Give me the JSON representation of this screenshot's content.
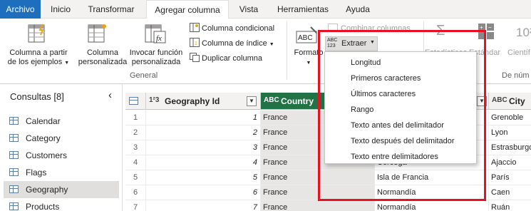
{
  "tabs": [
    "Archivo",
    "Inicio",
    "Transformar",
    "Agregar columna",
    "Vista",
    "Herramientas",
    "Ayuda"
  ],
  "ribbon": {
    "col_examples": [
      "Columna a partir",
      "de los ejemplos"
    ],
    "custom_col": [
      "Columna",
      "personalizada"
    ],
    "invoke_fn": [
      "Invocar función",
      "personalizada"
    ],
    "cond_col": "Columna condicional",
    "index_col": "Columna de índice",
    "dup_col": "Duplicar columna",
    "group_general": "General",
    "format": "Formato",
    "merge_cols": "Combinar columnas",
    "extract": "Extraer",
    "stats": "Estadísticas",
    "standard": "Estándar",
    "scientific": "Científ",
    "group_numbers": "De núm"
  },
  "extract_menu": [
    "Longitud",
    "Primeros caracteres",
    "Últimos caracteres",
    "Rango",
    "Texto antes del delimitador",
    "Texto después del delimitador",
    "Texto entre delimitadores"
  ],
  "queries": {
    "title": "Consultas [8]",
    "items": [
      "Calendar",
      "Category",
      "Customers",
      "Flags",
      "Geography",
      "Products"
    ],
    "selected": "Geography"
  },
  "grid": {
    "columns": [
      {
        "type": "1²3",
        "name": "Geography Id"
      },
      {
        "type": "ABC",
        "name": "Country"
      },
      {
        "type": "ABC",
        "name": "City"
      }
    ],
    "row_numbers": [
      "1",
      "2",
      "3",
      "4",
      "5",
      "6",
      "7"
    ],
    "geo_ids": [
      "1",
      "2",
      "3",
      "4",
      "5",
      "6",
      "7"
    ],
    "countries": [
      "France",
      "France",
      "France",
      "France",
      "France",
      "France",
      "France"
    ],
    "regions": [
      "",
      "",
      "",
      "Córcega",
      "Isla de Francia",
      "Normandía",
      "Normandía"
    ],
    "cities": [
      "Grenoble",
      "Lyon",
      "Estrasburgo",
      "Ajaccio",
      "París",
      "Caen",
      "Ruán"
    ]
  },
  "colors": {
    "file_tab": "#1d6fbd",
    "selected_header": "#217346",
    "highlight_border": "#e81123"
  }
}
